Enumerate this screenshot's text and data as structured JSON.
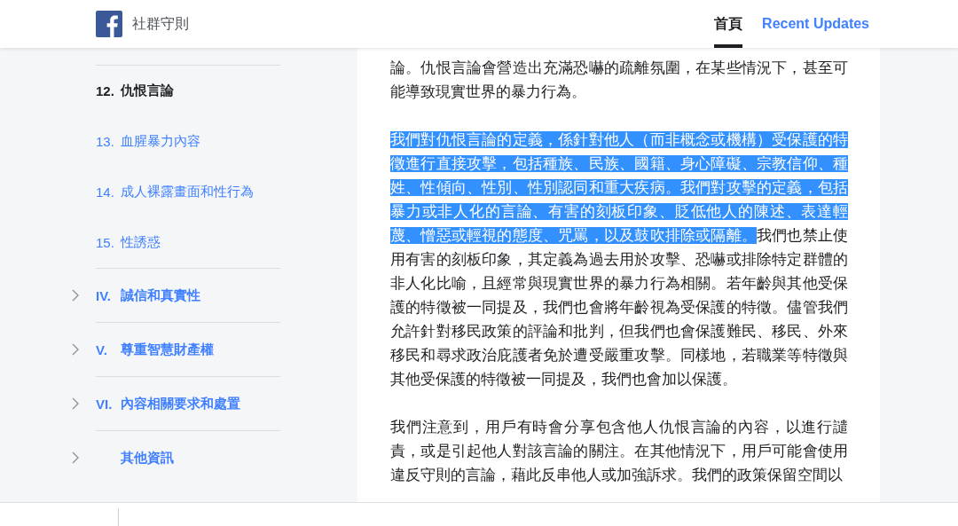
{
  "header": {
    "title": "社群守則",
    "nav": [
      {
        "label": "首頁",
        "selected": true
      },
      {
        "label": "Recent Updates",
        "selected": false
      }
    ]
  },
  "sidebar": {
    "items": [
      {
        "kind": "subsection",
        "number": "12.",
        "label": "仇恨言論",
        "selected": true
      },
      {
        "kind": "subsection",
        "number": "13.",
        "label": "血腥暴力內容",
        "selected": false
      },
      {
        "kind": "subsection",
        "number": "14.",
        "label": "成人裸露畫面和性行為",
        "selected": false
      },
      {
        "kind": "subsection",
        "number": "15.",
        "label": "性誘惑",
        "selected": false
      },
      {
        "kind": "section",
        "number": "IV.",
        "label": "誠信和真實性",
        "expanded": false
      },
      {
        "kind": "section",
        "number": "V.",
        "label": "尊重智慧財產權",
        "expanded": false
      },
      {
        "kind": "section",
        "number": "VI.",
        "label": "內容相關要求和處置",
        "expanded": false
      },
      {
        "kind": "section",
        "label": "其他資訊",
        "expanded": false
      }
    ]
  },
  "content": {
    "paragraphs": [
      {
        "segments": [
          {
            "text": "論。仇恨言論會營造出充滿恐嚇的疏離氛圍，在某些情況下，甚至可能導致現實世界的暴力行為。",
            "selected": false
          }
        ]
      },
      {
        "segments": [
          {
            "text": "我們對仇恨言論的定義，係針對他人（而非概念或機構）受保護的特徵進行直接攻擊，包括種族、民族、國籍、身心障礙、宗教信仰、種姓、性傾向、性別、性別認同和重大疾病。我們對攻擊的定義，包括暴力或非人化的言論、有害的刻板印象、貶低他人的陳述、表達輕蔑、憎惡或輕視的態度、咒罵，以及鼓吹排除或隔離。",
            "selected": true
          },
          {
            "text": "我們也禁止使用有害的刻板印象，其定義為過去用於攻擊、恐嚇或排除特定群體的非人化比喻，且經常與現實世界的暴力行為相關。若年齡與其他受保護的特徵被一同提及，我們也會將年齡視為受保護的特徵。儘管我們允許針對移民政策的評論和批判，但我們也會保護難民、移民、外來移民和尋求政治庇護者免於遭受嚴重攻擊。同樣地，若職業等特徵與其他受保護的特徵被一同提及，我們也會加以保護。",
            "selected": false
          }
        ]
      },
      {
        "segments": [
          {
            "text": "我們注意到，用戶有時會分享包含他人仇恨言論的內容，以進行譴責，或是引起他人對該言論的關注。在其他情況下，用戶可能會使用違反守則的言論，藉此反串他人或加強訴求。我們的政策保留空間以",
            "selected": false
          }
        ]
      }
    ]
  }
}
